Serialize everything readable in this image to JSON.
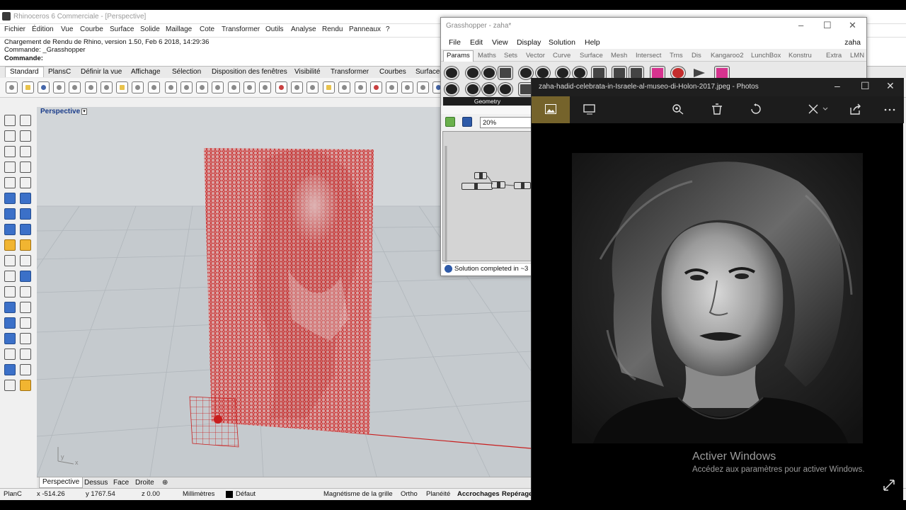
{
  "rhino": {
    "title": "Rhinoceros 6 Commerciale - [Perspective]",
    "menu": [
      "Fichier",
      "Édition",
      "Vue",
      "Courbe",
      "Surface",
      "Solide",
      "Maillage",
      "Cote",
      "Transformer",
      "Outils",
      "Analyse",
      "Rendu",
      "Panneaux",
      "?"
    ],
    "command_history": [
      "Chargement de Rendu de Rhino, version 1.50, Feb  6 2018, 14:29:36",
      "Commande: _Grasshopper"
    ],
    "command_prompt": "Commande:",
    "toolbar_tabs": [
      "Standard",
      "PlansC",
      "Définir la vue",
      "Affichage",
      "Sélection",
      "Disposition des fenêtres",
      "Visibilité",
      "Transformer",
      "Courbes",
      "Surfaces"
    ],
    "viewport_label": "Perspective",
    "viewport_tabs": [
      "Perspective",
      "Dessus",
      "Face",
      "Droite",
      "⊕"
    ],
    "axis_y": "y",
    "axis_x": "x",
    "status": {
      "plan": "PlanC",
      "x": "x -514.26",
      "y": "y 1767.54",
      "z": "z 0.00",
      "units": "Millimètres",
      "layer": "Défaut",
      "snap_grid": "Magnétisme de la grille",
      "ortho": "Ortho",
      "planarity": "Planéité",
      "osnap": "Accrochages",
      "smarttrack": "Repérage"
    }
  },
  "grasshopper": {
    "title": "Grasshopper - zaha*",
    "menu": [
      "File",
      "Edit",
      "View",
      "Display",
      "Solution",
      "Help"
    ],
    "user": "zaha",
    "tabs": [
      "Params",
      "Maths",
      "Sets",
      "Vector",
      "Curve",
      "Surface",
      "Mesh",
      "Intersect",
      "Trns",
      "Dis",
      "Kangaroo2",
      "LunchBox",
      "Konstru",
      "Extra",
      "LMN"
    ],
    "group_label": "Geometry",
    "zoom": "20%",
    "status": "Solution completed in ~3"
  },
  "photos": {
    "title": "zaha-hadid-celebrata-in-Israele-al-museo-di-Holon-2017.jpeg - Photos",
    "activate_title": "Activer Windows",
    "activate_sub": "Accédez aux paramètres pour activer Windows."
  },
  "colors": {
    "mesh_red": "#c81e1e",
    "viewport_bg": "#c5cace",
    "photos_accent": "#75632b"
  }
}
